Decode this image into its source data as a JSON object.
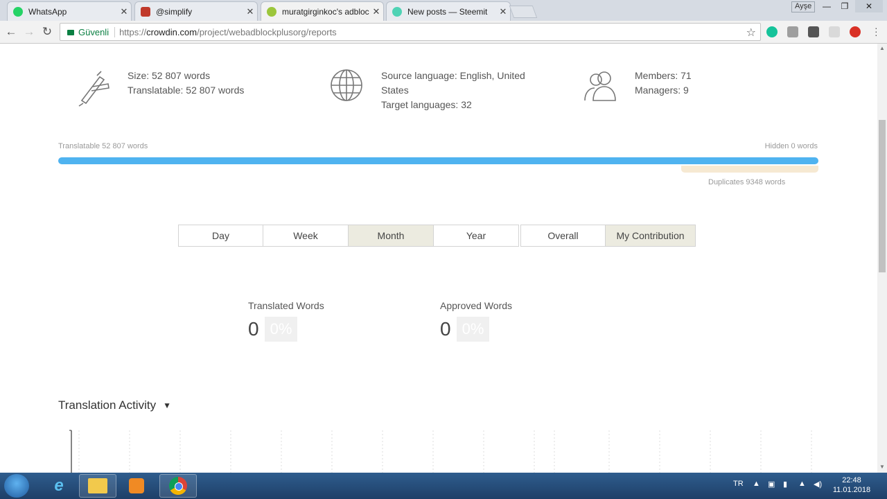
{
  "browser": {
    "tabs": [
      {
        "title": "WhatsApp",
        "favicon_color": "#25d366"
      },
      {
        "title": "@simplify",
        "favicon_color": "#c0392b"
      },
      {
        "title": "muratgirginkoc's adblock",
        "favicon_color": "#9cc63b"
      },
      {
        "title": "New posts — Steemit",
        "favicon_color": "#4fd3b5"
      }
    ],
    "window_user": "Ayşe",
    "secure_label": "Güvenli",
    "url_scheme": "https://",
    "url_host": "crowdin.com",
    "url_path": "/project/webadblockplusorg/reports"
  },
  "stats": {
    "size": "Size: 52 807 words",
    "translatable": "Translatable: 52 807 words",
    "source_language": "Source language: English, United States",
    "target_languages": "Target languages: 32",
    "members": "Members: 71",
    "managers": "Managers: 9"
  },
  "progress": {
    "translatable_label": "Translatable 52 807 words",
    "hidden_label": "Hidden 0 words",
    "duplicates_label": "Duplicates 9348 words",
    "translatable_words": 52807,
    "duplicates_words": 9348,
    "bar_color": "#4fb3f0",
    "duplicates_color": "#f6e9d2"
  },
  "period_tabs": [
    "Day",
    "Week",
    "Month",
    "Year"
  ],
  "period_selected": "Month",
  "scope_tabs": [
    "Overall",
    "My Contribution"
  ],
  "scope_selected": "My Contribution",
  "metrics": {
    "translated_label": "Translated Words",
    "translated_value": "0",
    "translated_pct": "0%",
    "approved_label": "Approved Words",
    "approved_value": "0",
    "approved_pct": "0%"
  },
  "section": {
    "title": "Translation Activity"
  },
  "taskbar": {
    "language": "TR",
    "time": "22:48",
    "date": "11.01.2018"
  }
}
